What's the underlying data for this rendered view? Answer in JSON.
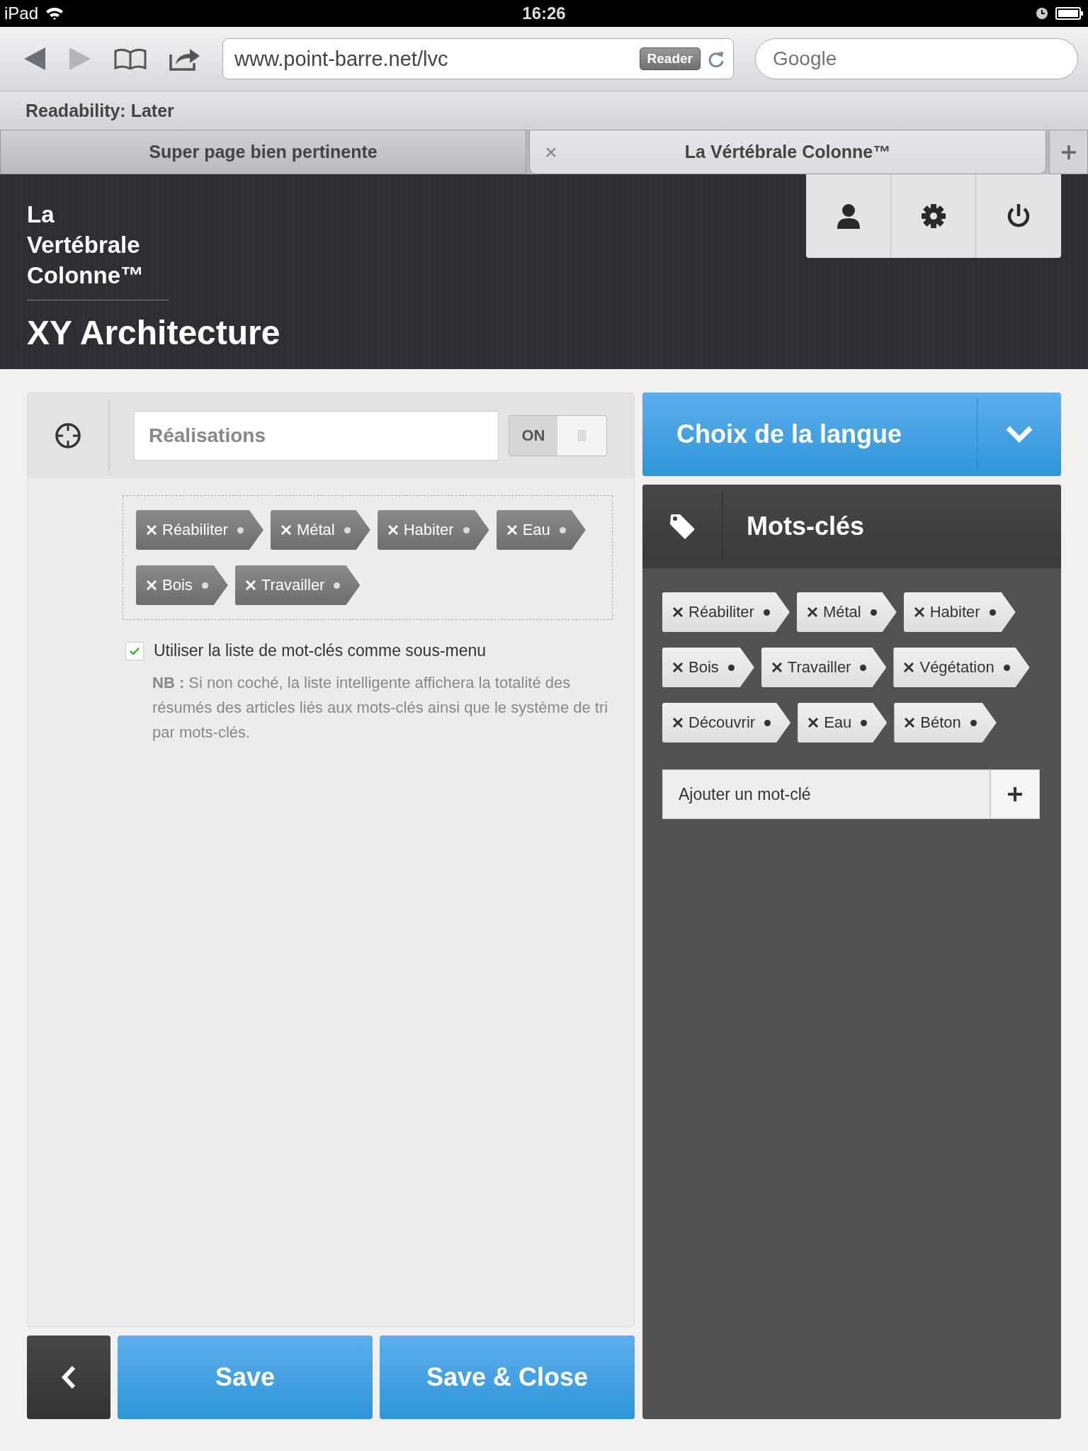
{
  "status_bar": {
    "device": "iPad",
    "time": "16:26"
  },
  "toolbar": {
    "url": "www.point-barre.net/lvc",
    "reader_button": "Reader",
    "search": {
      "placeholder": "Google"
    }
  },
  "bookmarks": [
    "Readability: Later"
  ],
  "tabs": [
    {
      "label": "Super page bien pertinente",
      "selected": false
    },
    {
      "label": "La Vértébrale Colonne™",
      "selected": true
    }
  ],
  "header": {
    "site_title": "La Vertébrale Colonne™",
    "page_title": "XY Architecture"
  },
  "editor": {
    "field": {
      "value": "Réalisations"
    },
    "toggle": {
      "label": "ON",
      "on": true
    },
    "tags": [
      "Réabiliter",
      "Métal",
      "Habiter",
      "Eau",
      "Bois",
      "Travailler"
    ],
    "checkbox": {
      "label": "Utiliser la liste de mot-clés comme sous-menu",
      "checked": true
    },
    "note": "**NB :** Si non coché, la liste intelligente affichera la totalité des résumés des articles liés aux mots-clés ainsi que le système de tri par mots-clés."
  },
  "language_dropdown": {
    "label": "Choix de la langue"
  },
  "keywords": {
    "title": "Mots-clés",
    "tags": [
      "Réabiliter",
      "Métal",
      "Habiter",
      "Bois",
      "Travailler",
      "Végétation",
      "Découvrir",
      "Eau",
      "Béton"
    ],
    "add_field": {
      "placeholder": "Ajouter un mot-clé"
    }
  },
  "buttons": [
    "Save",
    "Save & Close"
  ]
}
